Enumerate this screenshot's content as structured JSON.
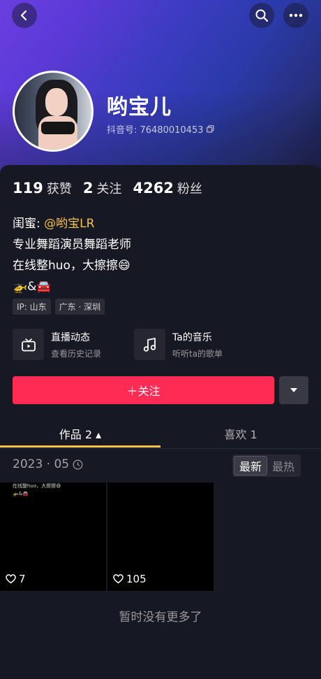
{
  "header": {
    "back_icon": "chevron-left-icon",
    "search_icon": "search-icon",
    "more_icon": "more-icon"
  },
  "profile": {
    "name": "哟宝儿",
    "douyin_id": "抖音号: 76480010453"
  },
  "stats": [
    {
      "value": "119",
      "label": "获赞"
    },
    {
      "value": "2",
      "label": "关注"
    },
    {
      "value": "4262",
      "label": "粉丝"
    }
  ],
  "bio": {
    "line1_prefix": "闺蜜: ",
    "line1_mention": "@哟宝LR",
    "line2": "专业舞蹈演员舞蹈老师",
    "line3": "在线整huo，大擦擦😄",
    "line4": "🚁&🚘"
  },
  "tags": [
    "IP: 山东",
    "广东 · 深圳"
  ],
  "features": [
    {
      "title": "直播动态",
      "subtitle": "查看历史记录",
      "icon": "tv-icon"
    },
    {
      "title": "Ta的音乐",
      "subtitle": "听听ta的歌单",
      "icon": "music-note-icon"
    }
  ],
  "actions": {
    "follow_label": "＋关注",
    "dropdown_icon": "triangle-down-icon"
  },
  "tabs": [
    {
      "label": "作品 2 ▴",
      "active": true
    },
    {
      "label": "喜欢 1",
      "active": false
    }
  ],
  "works": {
    "date": "2023 · 05",
    "sort_latest": "最新",
    "sort_hot": "最热"
  },
  "videos": [
    {
      "likes": "7",
      "overlay_line1": "在线整huo，大擦擦😄",
      "overlay_line2": "🚁&🚘"
    },
    {
      "likes": "105"
    }
  ],
  "footer": {
    "no_more": "暂时没有更多了"
  },
  "colors": {
    "accent_red": "#fe2c55",
    "mention_yellow": "#f8c244",
    "background": "#161823"
  }
}
